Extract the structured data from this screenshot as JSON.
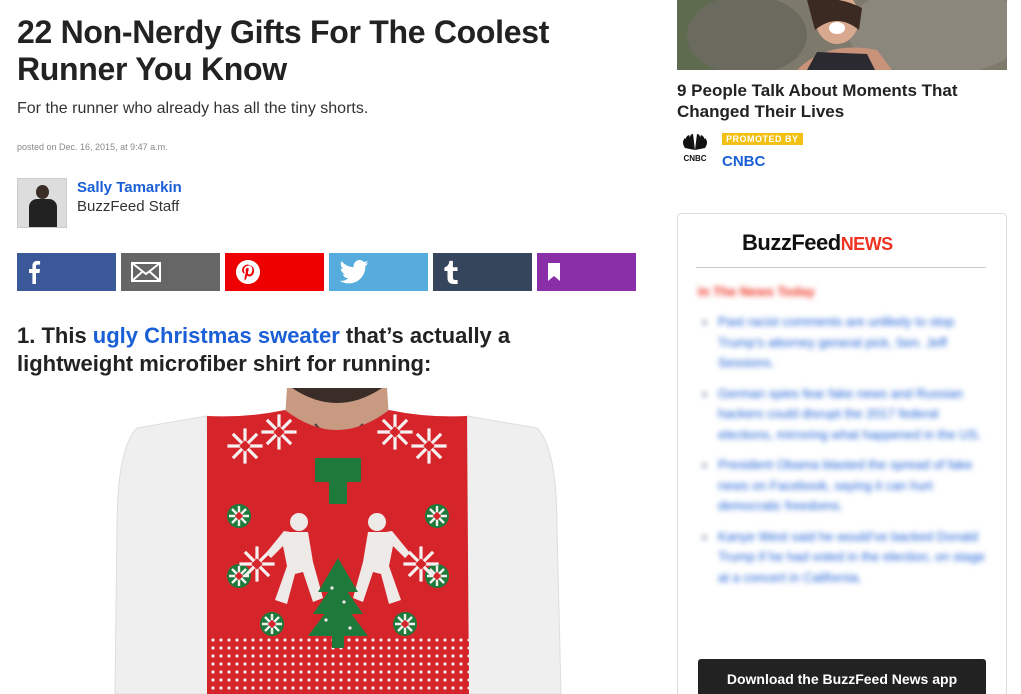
{
  "article": {
    "title": "22 Non-Nerdy Gifts For The Coolest Runner You Know",
    "subtitle": "For the runner who already has all the tiny shorts.",
    "posted": "posted on Dec. 16, 2015, at 9:47 a.m.",
    "author": {
      "name": "Sally Tamarkin",
      "role": "BuzzFeed Staff"
    },
    "share_buttons": [
      {
        "name": "facebook",
        "icon": "facebook-icon",
        "color": "#3b5998"
      },
      {
        "name": "email",
        "icon": "mail-icon",
        "color": "#666666"
      },
      {
        "name": "pinterest",
        "icon": "pinterest-icon",
        "color": "#ee0000"
      },
      {
        "name": "twitter",
        "icon": "twitter-icon",
        "color": "#55acdd"
      },
      {
        "name": "tumblr",
        "icon": "tumblr-icon",
        "color": "#35465c"
      },
      {
        "name": "save",
        "icon": "bookmark-icon",
        "color": "#8a2fa8"
      }
    ],
    "item": {
      "prefix": "1. This ",
      "link_text": "ugly Christmas sweater",
      "suffix": " that’s actually a lightweight microfiber shirt for running:"
    }
  },
  "promo": {
    "title": "9 People Talk About Moments That Changed Their Lives",
    "badge": "PROMOTED BY",
    "sponsor_logo_text": "CNBC",
    "sponsor": "CNBC"
  },
  "news_box": {
    "brand_main": "BuzzFeed",
    "brand_sub": "NEWS",
    "section": "In The News Today",
    "items": [
      "Past racist comments are unlikely to stop Trump’s attorney general pick, Sen. Jeff Sessions.",
      "German spies fear fake news and Russian hackers could disrupt the 2017 federal elections, mirroring what happened in the US.",
      "President Obama blasted the spread of fake news on Facebook, saying it can hurt democratic freedoms.",
      "Kanye West said he would’ve backed Donald Trump if he had voted in the election, on stage at a concert in California."
    ],
    "download_label": "Download the BuzzFeed News app"
  },
  "colors": {
    "link": "#1a5fd6",
    "news_red": "#ee3322",
    "promo_badge": "#f2c013",
    "sweater_red": "#d6242b",
    "sweater_green": "#1e7a3a"
  }
}
